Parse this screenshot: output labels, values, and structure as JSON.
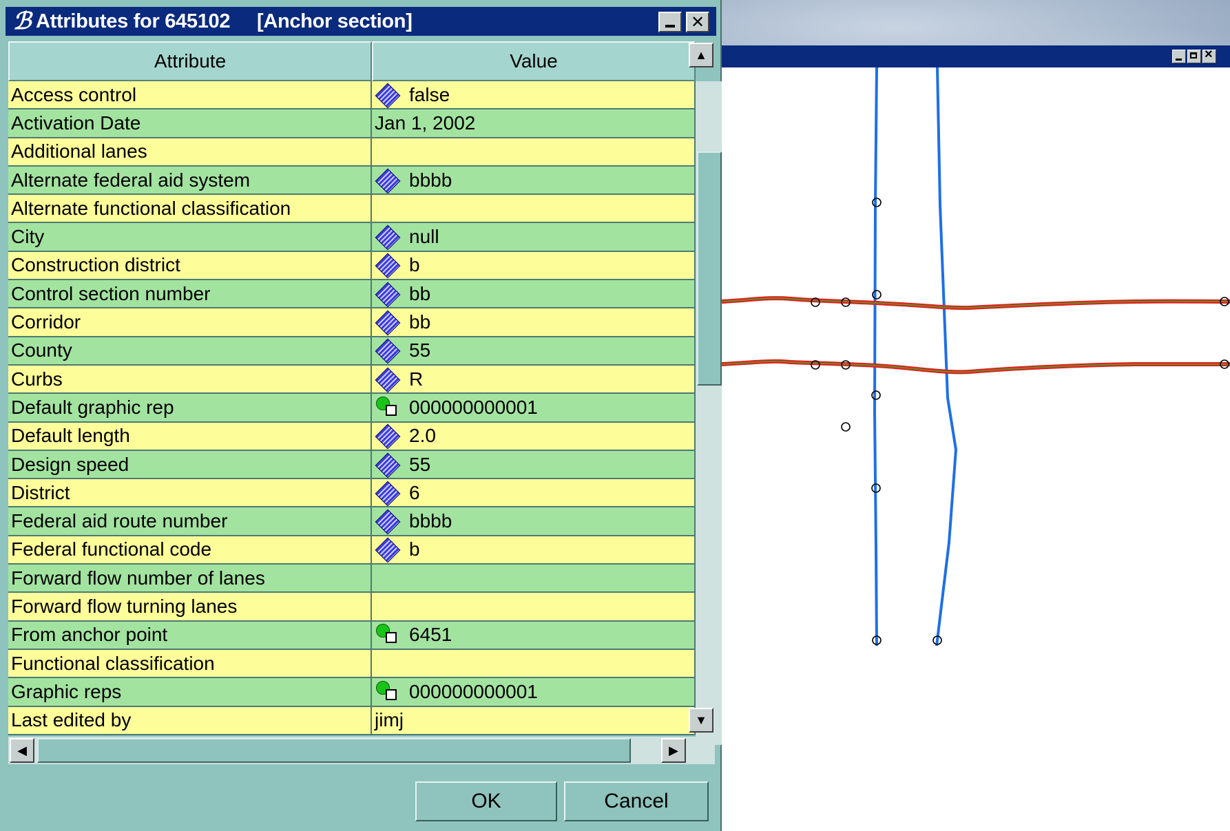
{
  "dialog": {
    "title": "Attributes for 645102     [Anchor section]",
    "logo_glyph": "ℬ",
    "columns": {
      "attribute": "Attribute",
      "value": "Value"
    },
    "rows": [
      {
        "attribute": "Access control",
        "value": "false",
        "icon": "value-icon"
      },
      {
        "attribute": "Activation Date",
        "value": "Jan 1, 2002",
        "icon": ""
      },
      {
        "attribute": "Additional lanes",
        "value": "",
        "icon": ""
      },
      {
        "attribute": "Alternate federal aid system",
        "value": "bbbb",
        "icon": "value-icon"
      },
      {
        "attribute": "Alternate functional classification",
        "value": "",
        "icon": ""
      },
      {
        "attribute": "City",
        "value": "null",
        "icon": "value-icon"
      },
      {
        "attribute": "Construction district",
        "value": "b",
        "icon": "value-icon"
      },
      {
        "attribute": "Control section number",
        "value": "bb",
        "icon": "value-icon"
      },
      {
        "attribute": "Corridor",
        "value": "bb",
        "icon": "value-icon"
      },
      {
        "attribute": "County",
        "value": "55",
        "icon": "value-icon"
      },
      {
        "attribute": "Curbs",
        "value": "R",
        "icon": "value-icon"
      },
      {
        "attribute": "Default graphic rep",
        "value": "000000000001",
        "icon": "reference-icon"
      },
      {
        "attribute": "Default length",
        "value": "2.0",
        "icon": "value-icon"
      },
      {
        "attribute": "Design speed",
        "value": "55",
        "icon": "value-icon"
      },
      {
        "attribute": "District",
        "value": "6",
        "icon": "value-icon"
      },
      {
        "attribute": "Federal aid route number",
        "value": "bbbb",
        "icon": "value-icon"
      },
      {
        "attribute": "Federal functional code",
        "value": "b",
        "icon": "value-icon"
      },
      {
        "attribute": "Forward flow number of lanes",
        "value": "",
        "icon": ""
      },
      {
        "attribute": "Forward flow turning lanes",
        "value": "",
        "icon": ""
      },
      {
        "attribute": "From anchor point",
        "value": "6451",
        "icon": "reference-icon"
      },
      {
        "attribute": "Functional classification",
        "value": "",
        "icon": ""
      },
      {
        "attribute": "Graphic reps",
        "value": "000000000001",
        "icon": "reference-icon"
      },
      {
        "attribute": "Last edited by",
        "value": "jimj",
        "icon": ""
      }
    ],
    "buttons": {
      "ok": "OK",
      "cancel": "Cancel"
    },
    "scroll_arrows": {
      "up": "▲",
      "down": "▼",
      "left": "◀",
      "right": "▶"
    }
  },
  "map_window": {
    "colors": {
      "road_blue": "#1e6fe6",
      "line_red": "#e41c1c",
      "line_green": "#6d8a2a",
      "point": "#000000"
    }
  }
}
